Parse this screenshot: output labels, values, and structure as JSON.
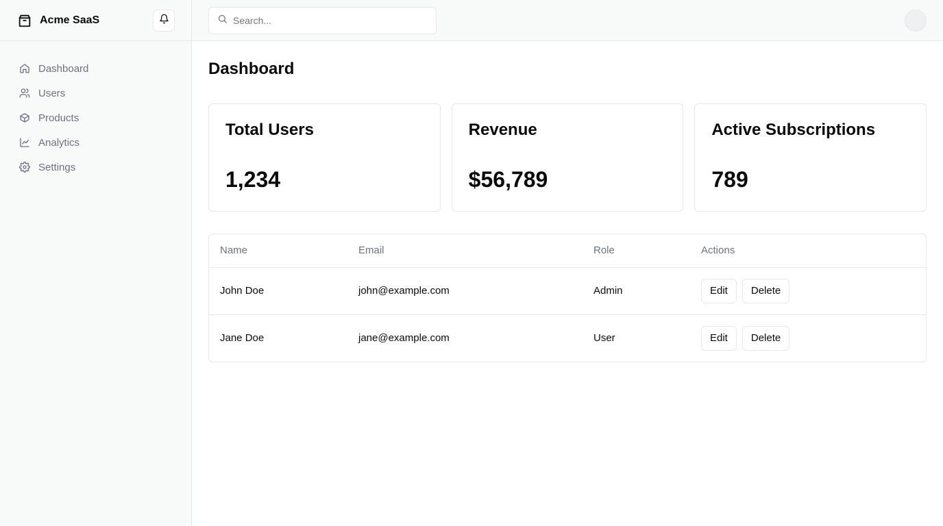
{
  "app": {
    "brand_name": "Acme SaaS",
    "brand_icon": "package-icon",
    "notification_icon": "bell-icon"
  },
  "sidebar": {
    "items": [
      {
        "label": "Dashboard",
        "icon": "home-icon"
      },
      {
        "label": "Users",
        "icon": "users-icon"
      },
      {
        "label": "Products",
        "icon": "box-icon"
      },
      {
        "label": "Analytics",
        "icon": "line-chart-icon"
      },
      {
        "label": "Settings",
        "icon": "gear-icon"
      }
    ]
  },
  "search": {
    "placeholder": "Search...",
    "value": ""
  },
  "page": {
    "title": "Dashboard"
  },
  "stats": [
    {
      "title": "Total Users",
      "value": "1,234"
    },
    {
      "title": "Revenue",
      "value": "$56,789"
    },
    {
      "title": "Active Subscriptions",
      "value": "789"
    }
  ],
  "table": {
    "headers": [
      "Name",
      "Email",
      "Role",
      "Actions"
    ],
    "rows": [
      {
        "name": "John Doe",
        "email": "john@example.com",
        "role": "Admin",
        "edit": "Edit",
        "delete": "Delete"
      },
      {
        "name": "Jane Doe",
        "email": "jane@example.com",
        "role": "User",
        "edit": "Edit",
        "delete": "Delete"
      }
    ]
  },
  "colors": {
    "sidebar_bg": "#f8f9f9",
    "border": "#e5e7eb",
    "muted_text": "#6b7280"
  }
}
